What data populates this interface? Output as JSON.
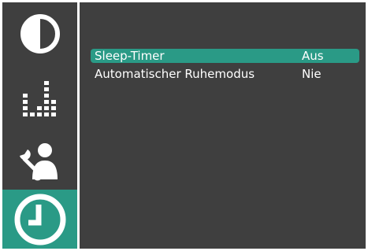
{
  "sidebar": {
    "items": [
      {
        "icon": "contrast-icon",
        "active": false
      },
      {
        "icon": "equalizer-icon",
        "active": false
      },
      {
        "icon": "settings-user-icon",
        "active": false
      },
      {
        "icon": "clock-icon",
        "active": true
      }
    ]
  },
  "colors": {
    "background": "#3f3f3f",
    "accent": "#2a9a86",
    "text": "#ffffff"
  },
  "menu": {
    "rows": [
      {
        "label": "Sleep-Timer",
        "value": "Aus",
        "selected": true
      },
      {
        "label": "Automatischer Ruhemodus",
        "value": "Nie",
        "selected": false
      }
    ]
  }
}
